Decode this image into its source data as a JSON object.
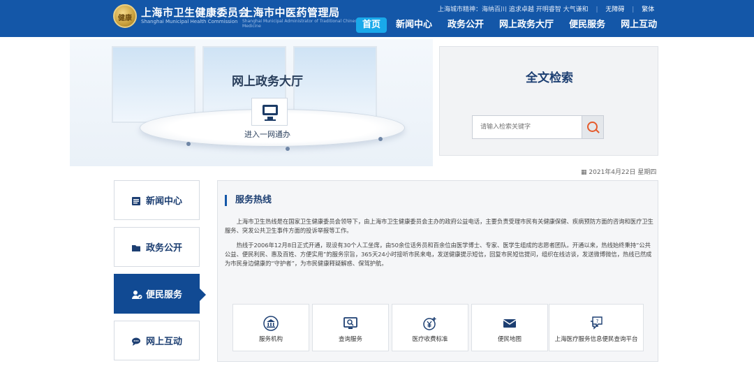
{
  "header": {
    "org_name_1": "上海市卫生健康委员会",
    "org_name_1_en": "Shanghai Municipal Health Commission",
    "org_name_2": "上海市中医药管理局",
    "org_name_2_en": "Shanghai Municipal Administrator of Traditional Chinese Medicine",
    "logo_text": "健康",
    "slogan": "上海城市精神：海纳百川 追求卓越 开明睿智 大气谦和",
    "accessibility": "无障碍",
    "traditional": "繁体",
    "nav": [
      "首页",
      "新闻中心",
      "政务公开",
      "网上政务大厅",
      "便民服务",
      "网上互动"
    ],
    "active_nav": "首页"
  },
  "hero": {
    "title": "网上政务大厅",
    "enter_label": "进入一网通办",
    "icon": "monitor-icon"
  },
  "search": {
    "title": "全文检索",
    "placeholder": "请输入检索关键字",
    "icon": "search-icon"
  },
  "date": "2021年4月22日 星期四",
  "sidebar": {
    "items": [
      {
        "label": "新闻中心",
        "icon": "news-icon"
      },
      {
        "label": "政务公开",
        "icon": "folder-icon"
      },
      {
        "label": "便民服务",
        "icon": "user-service-icon",
        "active": true
      },
      {
        "label": "网上互动",
        "icon": "chat-icon"
      }
    ]
  },
  "content": {
    "title": "服务热线",
    "para1": "上海市卫生热线是在国家卫生健康委员会领导下，由上海市卫生健康委员会主办的政府公益电话，主要负责受理市民有关健康保健、疾病预防方面的咨询和医疗卫生服务、突发公共卫生事件方面的投诉举报等工作。",
    "para2": "热线于2006年12月8日正式开通，现设有30个人工坐席，由50余位话务员和百余位由医学博士、专家、医学生组成的志愿者团队。开通以来，热线始终秉持“公共公益、便民利民、惠及百姓、方便实用”的服务宗旨，365天24小时接听市民来电，发送健康提示短信，回复市民短信提问，组织在线访谈，发送微博微信，热线已然成为市民身边健康的“守护者”，为市民健康释疑解惑、保驾护航。",
    "tiles": [
      {
        "label": "服务机构",
        "icon": "institution-icon"
      },
      {
        "label": "查询服务",
        "icon": "query-icon"
      },
      {
        "label": "医疗收费标准",
        "icon": "fee-icon"
      },
      {
        "label": "便民地图",
        "icon": "map-mail-icon"
      },
      {
        "label": "上海医疗服务信息便民查询平台",
        "icon": "help-chat-icon"
      }
    ]
  },
  "colors": {
    "header_bg": "#1457a8",
    "nav_active": "#19a9ea",
    "sidebar_active": "#114a93",
    "title_text": "#1d3f72",
    "search_icon": "#e55a2b"
  }
}
